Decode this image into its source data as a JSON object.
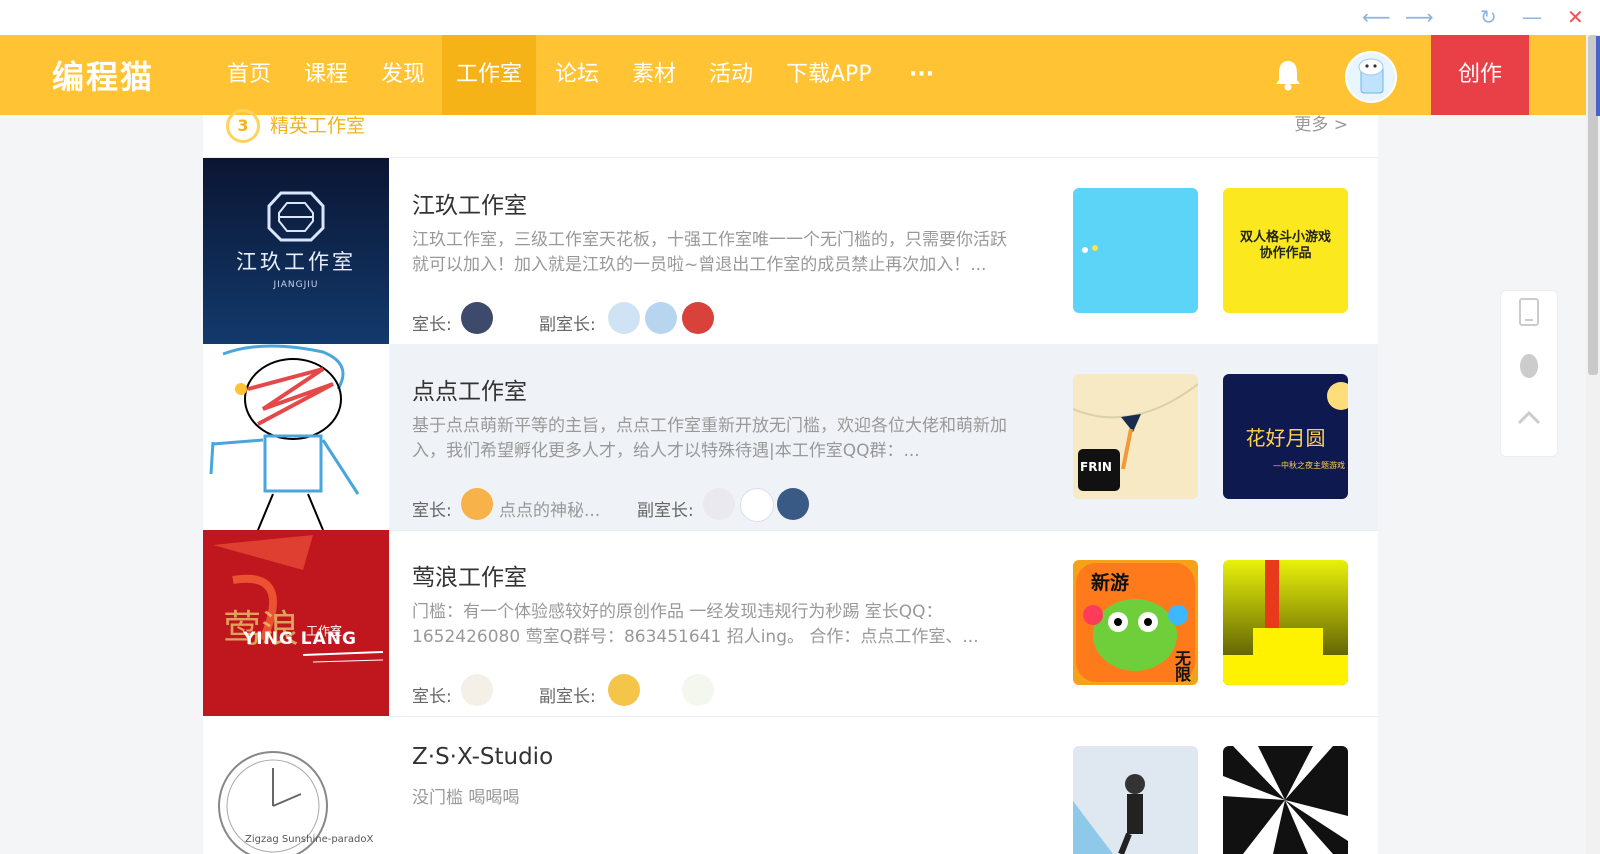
{
  "window": {
    "back_glyph": "⟵",
    "forward_glyph": "⟶",
    "refresh_glyph": "↻",
    "minimize_glyph": "—",
    "close_glyph": "✕"
  },
  "navbar": {
    "logo": "编程猫",
    "items": [
      "首页",
      "课程",
      "发现",
      "工作室",
      "论坛",
      "素材",
      "活动",
      "下载APP",
      "···"
    ],
    "active_index": 3,
    "create_label": "创作"
  },
  "section": {
    "badge": "3",
    "title": "精英工作室",
    "more": "更多 >"
  },
  "labels": {
    "owner": "室长:",
    "deputy": "副室长:"
  },
  "studios": [
    {
      "name": "江玖工作室",
      "desc": "江玖工作室，三级工作室天花板，十强工作室唯一一个无门槛的，只需要你活跃就可以加入！加入就是江玖的一员啦~曾退出工作室的成员禁止再次加入！...",
      "cover_title": "江玖工作室",
      "cover_sub": "JIANGJIU",
      "owner_name": ""
    },
    {
      "name": "点点工作室",
      "desc": "基于点点萌新平等的主旨，点点工作室重新开放无门槛，欢迎各位大佬和萌新加入，我们希望孵化更多人才，给人才以特殊待遇|本工作室QQ群：...",
      "owner_name": "点点的神秘...",
      "work_text": "花好月圆",
      "work_sub": "—中秋之夜主题游戏",
      "work_badge": "FRIN"
    },
    {
      "name": "莺浪工作室",
      "desc": "门槛：有一个体验感较好的原创作品 一经发现违规行为秒踢 室长QQ：1652426080 莺室Q群号：863451641 招人ing。 合作：点点工作室、...",
      "cover_title": "莺浪",
      "cover_sub": "YING LANG",
      "cover_small": "工作室",
      "owner_name": "",
      "work_text": "新游",
      "work_badge": "无限"
    },
    {
      "name": "Z·S·X-Studio",
      "desc": "没门槛 喝喝喝",
      "cover_sub": "Zigzag Sunshine-paradoX"
    }
  ],
  "works_text": {
    "studio1_work2": "双人格斗小游戏\n协作作品"
  },
  "colors": {
    "nav_bg": "#ffc333",
    "nav_active": "#f5b318",
    "create_bg": "#e94048",
    "row_highlight": "#eff2f6"
  }
}
